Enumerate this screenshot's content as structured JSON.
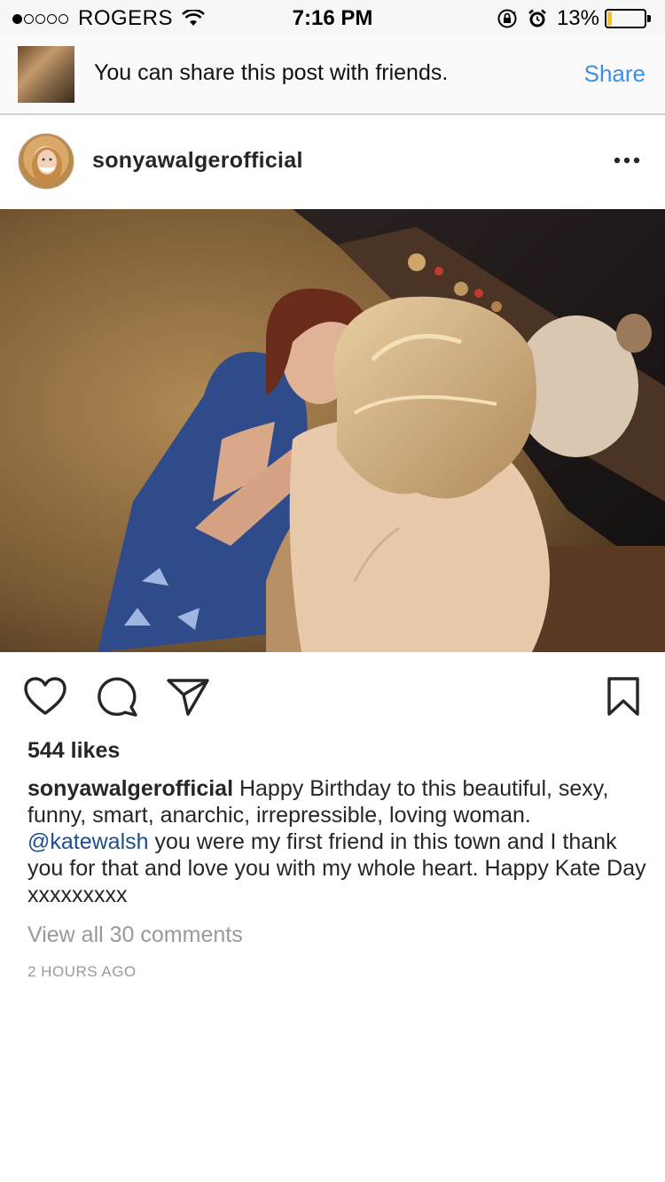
{
  "status_bar": {
    "signal_strength": 1,
    "signal_max": 5,
    "carrier": "ROGERS",
    "time": "7:16 PM",
    "battery": "13%",
    "battery_level": 0.13,
    "battery_color": "#f5c518"
  },
  "share_banner": {
    "message": "You can share this post with friends.",
    "action": "Share",
    "action_color": "#3d8ee6"
  },
  "post": {
    "username": "sonyawalgerofficial",
    "more_icon": "ellipsis-icon",
    "likes": "544 likes",
    "caption": {
      "user": "sonyawalgerofficial",
      "part1": " Happy Birthday to this beautiful, sexy, funny, smart, anarchic, irrepressible, loving woman. ",
      "mention": "@katewalsh",
      "part2": " you were my first friend in this town and I thank you for that and love you with my whole heart. Happy Kate Day xxxxxxxxx",
      "mention_color": "#1b4f8f"
    },
    "view_comments": "View all 30 comments",
    "timestamp": "2 HOURS AGO"
  },
  "action_icons": [
    "heart-icon",
    "comment-icon",
    "share-send-icon",
    "bookmark-icon"
  ]
}
